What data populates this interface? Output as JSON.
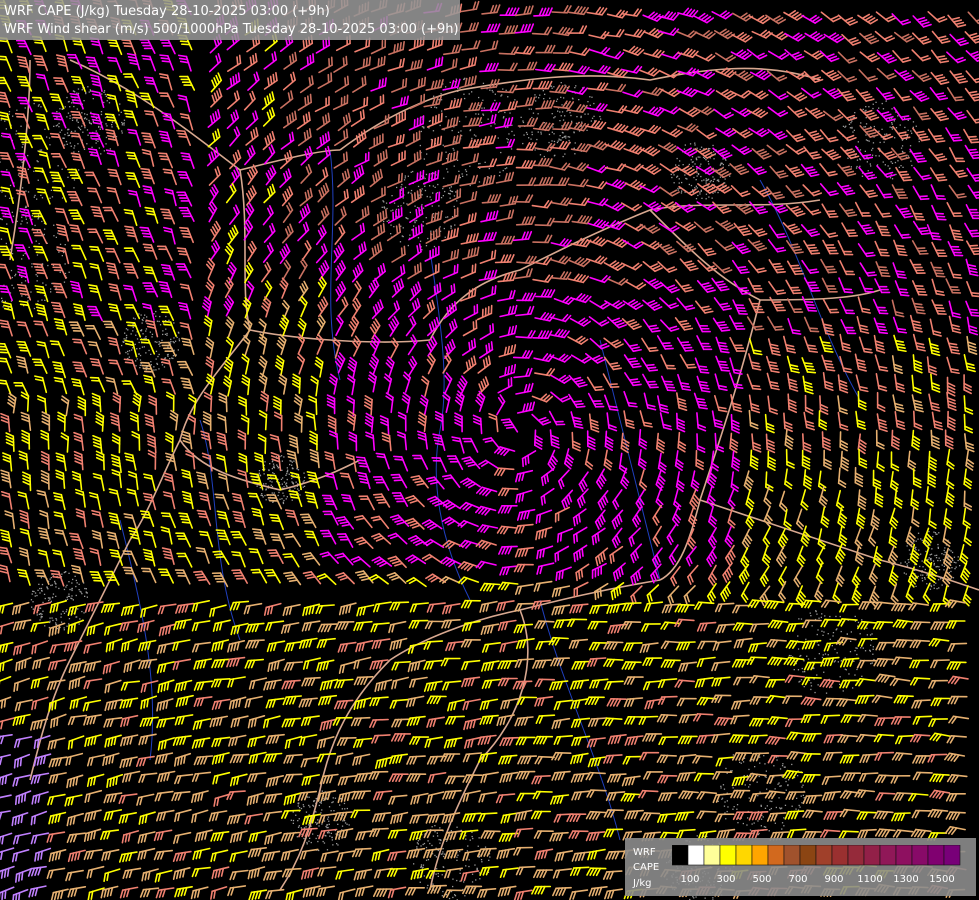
{
  "titles": {
    "line1": "WRF CAPE (J/kg) Tuesday 28-10-2025 03:00 (+9h)",
    "line2": "WRF Wind shear (m/s) 500/1000hPa Tuesday 28-10-2025 03:00 (+9h)"
  },
  "legend": {
    "model_label": "WRF",
    "field_label": "CAPE",
    "unit_label": "J/kg",
    "tick_labels": [
      "100",
      "300",
      "500",
      "700",
      "900",
      "1100",
      "1300",
      "1500"
    ],
    "colors": [
      "#000000",
      "#ffffff",
      "#ffff99",
      "#ffff00",
      "#ffd700",
      "#ffa500",
      "#d2691e",
      "#a0522d",
      "#8b4513",
      "#a0402a",
      "#9a3030",
      "#952a3a",
      "#922048",
      "#901858",
      "#8e1060",
      "#880a68",
      "#800070",
      "#780078"
    ]
  },
  "barb_colors": {
    "yellow": "#ffff00",
    "tan": "#e6b070",
    "salmon": "#f08070",
    "brown": "#c87060",
    "magenta": "#ff00ff",
    "lilac": "#c080ff"
  },
  "map_colors": {
    "border": "#d8a890",
    "river": "#2040c0",
    "cape_speckle": "#9a9a9a"
  }
}
